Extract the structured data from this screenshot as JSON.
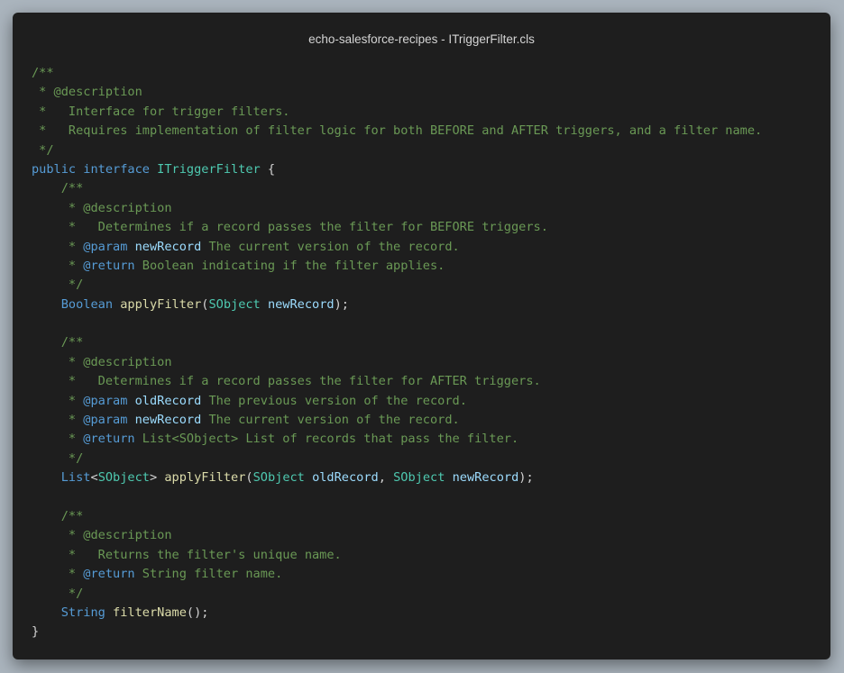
{
  "window": {
    "title": "echo-salesforce-recipes - ITriggerFilter.cls"
  },
  "colors": {
    "background": "#aab4bd",
    "editor": "#1e1e1e",
    "comment": "#6a9955",
    "keyword": "#569cd6",
    "type": "#4ec9b0",
    "function": "#dcdcaa",
    "variable": "#9cdcfe",
    "text": "#d4d4d4"
  },
  "code": {
    "lines": [
      [
        {
          "t": "/**",
          "c": "comment"
        }
      ],
      [
        {
          "t": " * @description",
          "c": "comment"
        }
      ],
      [
        {
          "t": " *   Interface for trigger filters.",
          "c": "comment"
        }
      ],
      [
        {
          "t": " *   Requires implementation of filter logic for both BEFORE and AFTER triggers, and a filter name.",
          "c": "comment"
        }
      ],
      [
        {
          "t": " */",
          "c": "comment"
        }
      ],
      [
        {
          "t": "public",
          "c": "keyword"
        },
        {
          "t": " ",
          "c": "plain"
        },
        {
          "t": "interface",
          "c": "keyword"
        },
        {
          "t": " ",
          "c": "plain"
        },
        {
          "t": "ITriggerFilter",
          "c": "type"
        },
        {
          "t": " {",
          "c": "punct"
        }
      ],
      [
        {
          "t": "    /**",
          "c": "comment"
        }
      ],
      [
        {
          "t": "     * @description",
          "c": "comment"
        }
      ],
      [
        {
          "t": "     *   Determines if a record passes the filter for BEFORE triggers.",
          "c": "comment"
        }
      ],
      [
        {
          "t": "     * ",
          "c": "comment"
        },
        {
          "t": "@param",
          "c": "tag"
        },
        {
          "t": " ",
          "c": "comment"
        },
        {
          "t": "newRecord",
          "c": "param"
        },
        {
          "t": " The current version of the record.",
          "c": "comment"
        }
      ],
      [
        {
          "t": "     * ",
          "c": "comment"
        },
        {
          "t": "@return",
          "c": "tag"
        },
        {
          "t": " Boolean indicating if the filter applies.",
          "c": "comment"
        }
      ],
      [
        {
          "t": "     */",
          "c": "comment"
        }
      ],
      [
        {
          "t": "    ",
          "c": "plain"
        },
        {
          "t": "Boolean",
          "c": "keyword"
        },
        {
          "t": " ",
          "c": "plain"
        },
        {
          "t": "applyFilter",
          "c": "func"
        },
        {
          "t": "(",
          "c": "punct"
        },
        {
          "t": "SObject",
          "c": "type"
        },
        {
          "t": " ",
          "c": "plain"
        },
        {
          "t": "newRecord",
          "c": "var"
        },
        {
          "t": ");",
          "c": "punct"
        }
      ],
      [],
      [
        {
          "t": "    /**",
          "c": "comment"
        }
      ],
      [
        {
          "t": "     * @description",
          "c": "comment"
        }
      ],
      [
        {
          "t": "     *   Determines if a record passes the filter for AFTER triggers.",
          "c": "comment"
        }
      ],
      [
        {
          "t": "     * ",
          "c": "comment"
        },
        {
          "t": "@param",
          "c": "tag"
        },
        {
          "t": " ",
          "c": "comment"
        },
        {
          "t": "oldRecord",
          "c": "param"
        },
        {
          "t": " The previous version of the record.",
          "c": "comment"
        }
      ],
      [
        {
          "t": "     * ",
          "c": "comment"
        },
        {
          "t": "@param",
          "c": "tag"
        },
        {
          "t": " ",
          "c": "comment"
        },
        {
          "t": "newRecord",
          "c": "param"
        },
        {
          "t": " The current version of the record.",
          "c": "comment"
        }
      ],
      [
        {
          "t": "     * ",
          "c": "comment"
        },
        {
          "t": "@return",
          "c": "tag"
        },
        {
          "t": " List<SObject> List of records that pass the filter.",
          "c": "comment"
        }
      ],
      [
        {
          "t": "     */",
          "c": "comment"
        }
      ],
      [
        {
          "t": "    ",
          "c": "plain"
        },
        {
          "t": "List",
          "c": "keyword"
        },
        {
          "t": "<",
          "c": "punct"
        },
        {
          "t": "SObject",
          "c": "type"
        },
        {
          "t": "> ",
          "c": "punct"
        },
        {
          "t": "applyFilter",
          "c": "func"
        },
        {
          "t": "(",
          "c": "punct"
        },
        {
          "t": "SObject",
          "c": "type"
        },
        {
          "t": " ",
          "c": "plain"
        },
        {
          "t": "oldRecord",
          "c": "var"
        },
        {
          "t": ", ",
          "c": "punct"
        },
        {
          "t": "SObject",
          "c": "type"
        },
        {
          "t": " ",
          "c": "plain"
        },
        {
          "t": "newRecord",
          "c": "var"
        },
        {
          "t": ");",
          "c": "punct"
        }
      ],
      [],
      [
        {
          "t": "    /**",
          "c": "comment"
        }
      ],
      [
        {
          "t": "     * @description",
          "c": "comment"
        }
      ],
      [
        {
          "t": "     *   Returns the filter's unique name.",
          "c": "comment"
        }
      ],
      [
        {
          "t": "     * ",
          "c": "comment"
        },
        {
          "t": "@return",
          "c": "tag"
        },
        {
          "t": " String filter name.",
          "c": "comment"
        }
      ],
      [
        {
          "t": "     */",
          "c": "comment"
        }
      ],
      [
        {
          "t": "    ",
          "c": "plain"
        },
        {
          "t": "String",
          "c": "keyword"
        },
        {
          "t": " ",
          "c": "plain"
        },
        {
          "t": "filterName",
          "c": "func"
        },
        {
          "t": "();",
          "c": "punct"
        }
      ],
      [
        {
          "t": "}",
          "c": "punct"
        }
      ]
    ]
  }
}
